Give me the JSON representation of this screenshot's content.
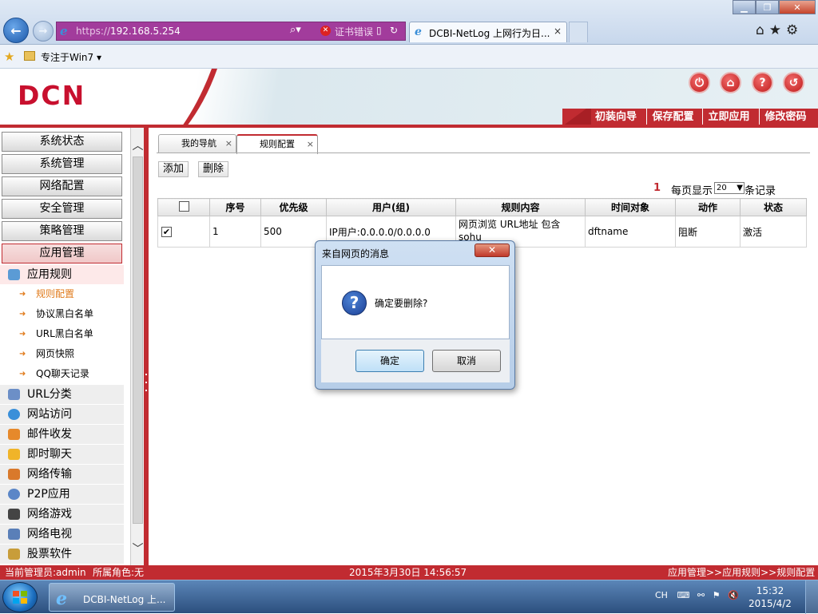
{
  "browser": {
    "address": {
      "protocol": "https://",
      "host": "192.168.5.254",
      "cert_error": "证书错误"
    },
    "tab": {
      "title": "DCBI-NetLog 上网行为日...",
      "close": "×"
    },
    "favorites": {
      "label": "专注于Win7",
      "dropdown": "▾"
    }
  },
  "header": {
    "logo": "DCN",
    "menu": [
      "初装向导",
      "保存配置",
      "立即应用",
      "修改密码"
    ]
  },
  "sidebar": {
    "main_menu": [
      "系统状态",
      "系统管理",
      "网络配置",
      "安全管理",
      "策略管理",
      "应用管理"
    ],
    "active_index": 5,
    "app_rules": {
      "label": "应用规则",
      "items": [
        "规则配置",
        "协议黑白名单",
        "URL黑白名单",
        "网页快照",
        "QQ聊天记录"
      ],
      "selected_index": 0
    },
    "categories": [
      "URL分类",
      "网站访问",
      "邮件收发",
      "即时聊天",
      "网络传输",
      "P2P应用",
      "网络游戏",
      "网络电视",
      "股票软件"
    ]
  },
  "main": {
    "tabs": [
      {
        "label": "我的导航",
        "close": "×"
      },
      {
        "label": "规则配置",
        "close": "×"
      }
    ],
    "toolbar": {
      "add": "添加",
      "delete": "删除"
    },
    "pagination": {
      "page": "1",
      "per_page_label": "每页显示",
      "per_page": "20",
      "records_label": "条记录"
    },
    "table": {
      "headers": [
        "",
        "序号",
        "优先级",
        "用户(组)",
        "规则内容",
        "时间对象",
        "动作",
        "状态"
      ],
      "rows": [
        {
          "checked": "✔",
          "id": "1",
          "priority": "500",
          "user": "IP用户:0.0.0.0/0.0.0.0",
          "content": "网页浏览 URL地址 包含 sohu",
          "time": "dftname",
          "action": "阻断",
          "status": "激活"
        }
      ]
    }
  },
  "dialog": {
    "title": "来自网页的消息",
    "close": "✕",
    "icon": "?",
    "message": "确定要删除?",
    "ok": "确定",
    "cancel": "取消"
  },
  "statusbar": {
    "admin": "当前管理员:admin",
    "role": "所属角色:无",
    "datetime": "2015年3月30日 14:56:57",
    "breadcrumb": "应用管理>>应用规则>>规则配置"
  },
  "taskbar": {
    "task_label": "DCBI-NetLog 上...",
    "lang": "CH",
    "time": "15:32",
    "date": "2015/4/2"
  },
  "colors": {
    "brand_red": "#c12b31",
    "address_bar": "#a23c9c",
    "highlight_orange": "#e07a1a"
  },
  "icons": [
    "back-arrow-icon",
    "forward-arrow-icon",
    "ie-logo-icon",
    "search-icon",
    "certificate-error-icon",
    "refresh-icon",
    "home-icon",
    "favorites-star-icon",
    "tools-gear-icon",
    "folder-icon",
    "question-icon",
    "windows-logo-icon"
  ]
}
